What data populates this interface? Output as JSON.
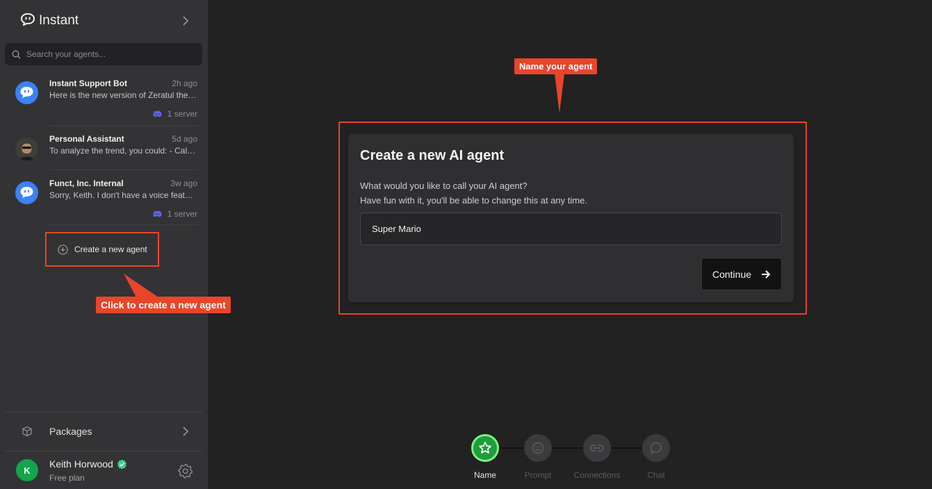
{
  "app": {
    "name": "Instant"
  },
  "search": {
    "placeholder": "Search your agents..."
  },
  "agents": [
    {
      "name": "Instant Support Bot",
      "time": "2h ago",
      "preview": "Here is the new version of Zeratul the fallen",
      "servers": "1 server"
    },
    {
      "name": "Personal Assistant",
      "time": "5d ago",
      "preview": "To analyze the trend, you could: - Calculate",
      "servers": ""
    },
    {
      "name": "Funct, Inc. Internal",
      "time": "3w ago",
      "preview": "Sorry, Keith. I don't have a voice feature yet",
      "servers": "1 server"
    }
  ],
  "create_agent": {
    "label": "Create a new agent"
  },
  "callouts": {
    "create": "Click to create a new agent",
    "name": "Name your agent"
  },
  "packages": {
    "label": "Packages"
  },
  "user": {
    "name": "Keith Horwood",
    "initial": "K",
    "plan": "Free plan"
  },
  "modal": {
    "title": "Create a new AI agent",
    "line1": "What would you like to call your AI agent?",
    "line2": "Have fun with it, you'll be able to change this at any time.",
    "input_value": "Super Mario",
    "continue_label": "Continue"
  },
  "steps": [
    {
      "label": "Name",
      "active": true,
      "icon": "star-icon"
    },
    {
      "label": "Prompt",
      "active": false,
      "icon": "smile-icon"
    },
    {
      "label": "Connections",
      "active": false,
      "icon": "link-icon"
    },
    {
      "label": "Chat",
      "active": false,
      "icon": "chat-bubble-icon"
    }
  ],
  "colors": {
    "sidebar_bg": "#333335",
    "main_bg": "#222223",
    "callout": "#e8452b",
    "active_step": "#1f9d3d",
    "discord": "#5865f2",
    "bot_avatar": "#3b82f6"
  }
}
